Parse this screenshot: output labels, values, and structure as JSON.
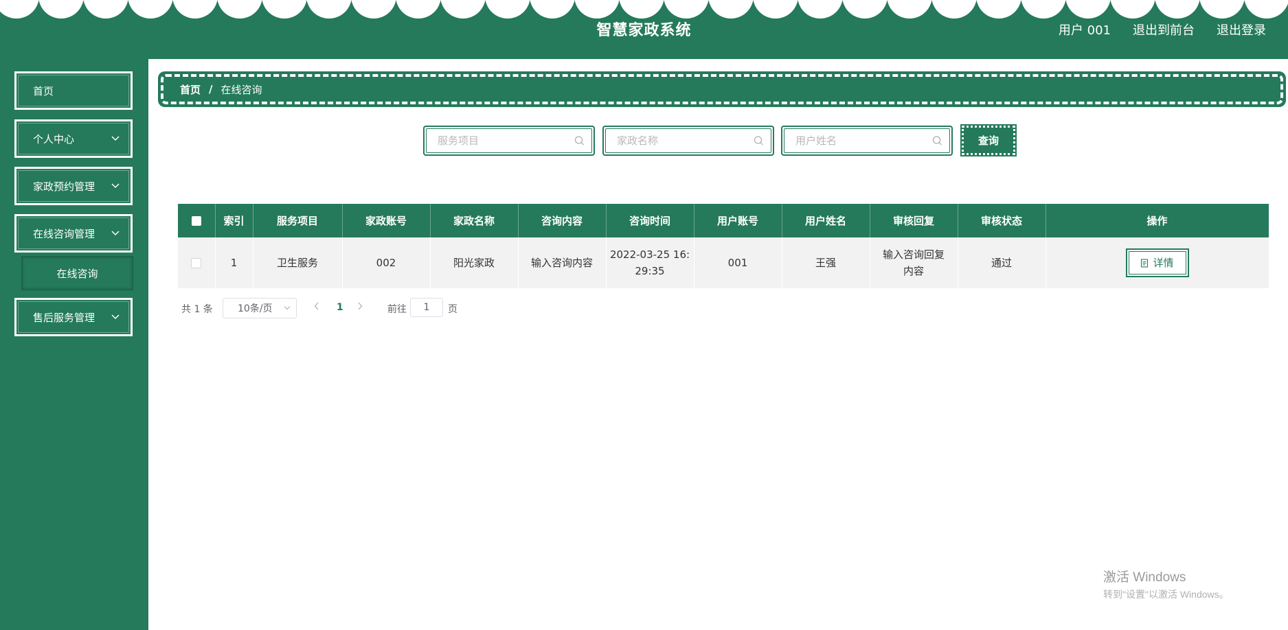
{
  "header": {
    "title": "智慧家政系统",
    "user": "用户 001",
    "back_to_front": "退出到前台",
    "logout": "退出登录"
  },
  "sidebar": {
    "items": [
      {
        "label": "首页"
      },
      {
        "label": "个人中心"
      },
      {
        "label": "家政预约管理"
      },
      {
        "label": "在线咨询管理"
      },
      {
        "label": "在线咨询"
      },
      {
        "label": "售后服务管理"
      }
    ]
  },
  "breadcrumb": {
    "home": "首页",
    "separator": "/",
    "current": "在线咨询"
  },
  "search": {
    "service_placeholder": "服务项目",
    "company_placeholder": "家政名称",
    "username_placeholder": "用户姓名",
    "query_label": "查询"
  },
  "table": {
    "columns": [
      "索引",
      "服务项目",
      "家政账号",
      "家政名称",
      "咨询内容",
      "咨询时间",
      "用户账号",
      "用户姓名",
      "审核回复",
      "审核状态",
      "操作"
    ],
    "rows": [
      {
        "index": "1",
        "service": "卫生服务",
        "company_account": "002",
        "company_name": "阳光家政",
        "content": "输入咨询内容",
        "time": "2022-03-25 16:29:35",
        "user_account": "001",
        "user_name": "王强",
        "reply": "输入咨询回复内容",
        "status": "通过",
        "action": "详情"
      }
    ]
  },
  "pagination": {
    "total": "共 1 条",
    "page_size": "10条/页",
    "current_page": "1",
    "goto_label": "前往",
    "goto_value": "1",
    "page_suffix": "页"
  },
  "watermark": {
    "line1": "激活 Windows",
    "line2": "转到\"设置\"以激活 Windows。"
  },
  "colors": {
    "primary": "#247a5b",
    "row_bg": "#f2f2f2"
  }
}
